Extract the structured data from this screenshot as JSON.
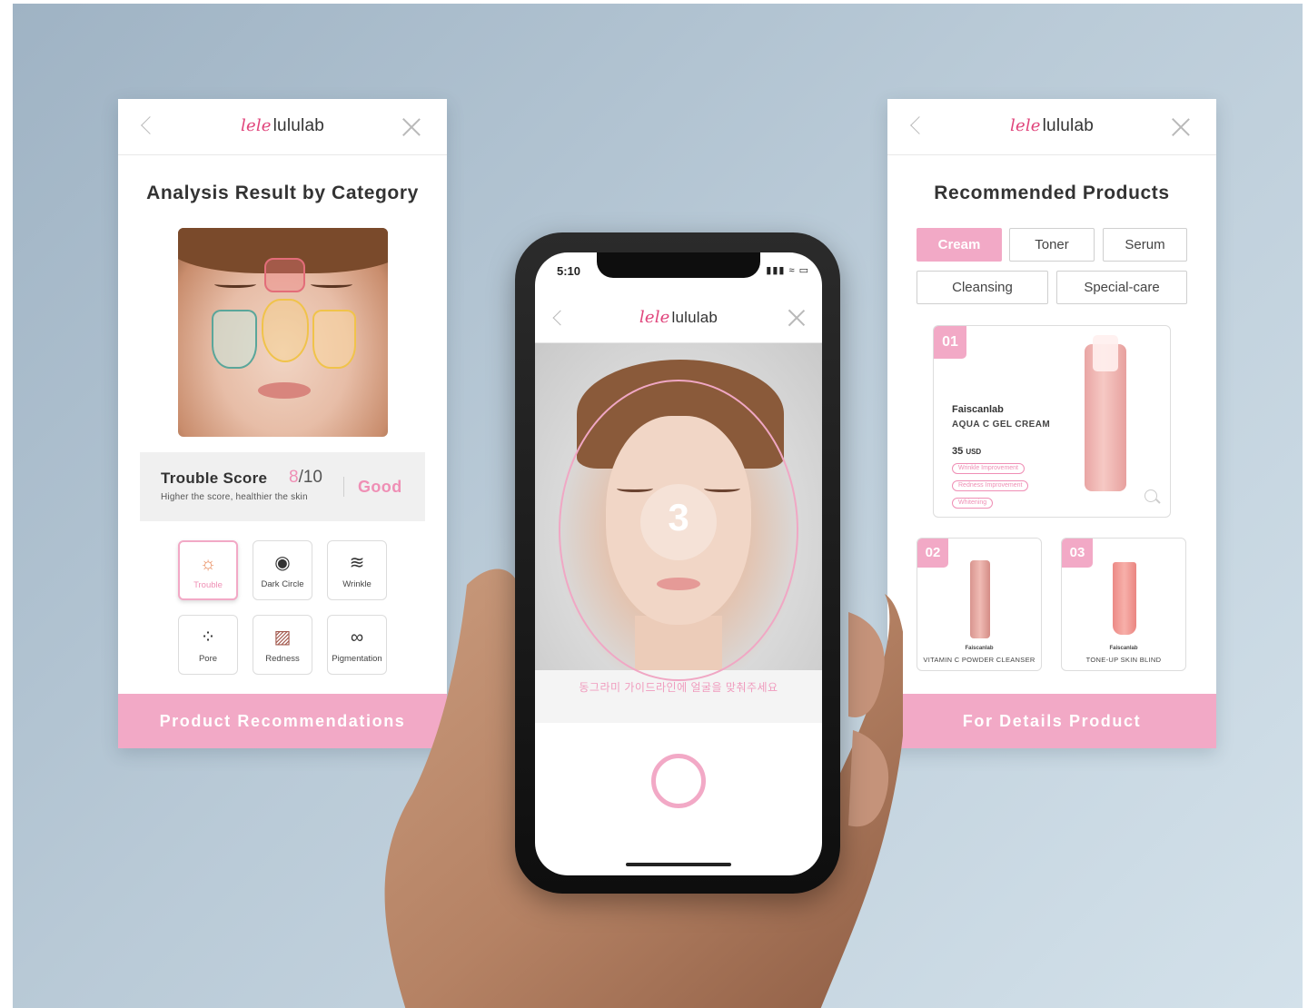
{
  "brand": {
    "logo_mark": "lele",
    "logo_text": "lululab"
  },
  "left_card": {
    "title": "Analysis Result by Category",
    "score": {
      "title": "Trouble Score",
      "value": "8",
      "max": "/10",
      "subtitle": "Higher the score, healthier the skin",
      "grade": "Good"
    },
    "categories": [
      {
        "label": "Trouble",
        "icon": "trouble-icon",
        "glyph": "☼"
      },
      {
        "label": "Dark Circle",
        "icon": "dark-circle-icon",
        "glyph": "◉"
      },
      {
        "label": "Wrinkle",
        "icon": "wrinkle-icon",
        "glyph": "≋"
      },
      {
        "label": "Pore",
        "icon": "pore-icon",
        "glyph": "⁘"
      },
      {
        "label": "Redness",
        "icon": "redness-icon",
        "glyph": "▨"
      },
      {
        "label": "Pigmentation",
        "icon": "pigmentation-icon",
        "glyph": "∞"
      }
    ],
    "active_category": "Trouble",
    "button": "Product Recommendations"
  },
  "phone": {
    "time": "5:10",
    "status_icons": "▮▮▮ ≈ ▭",
    "countdown": "3",
    "guide_text": "동그라미 가이드라인에 얼굴을 맞춰주세요"
  },
  "right_card": {
    "title": "Recommended Products",
    "tabs": [
      "Cream",
      "Toner",
      "Serum",
      "Cleansing",
      "Special-care"
    ],
    "active_tab": "Cream",
    "products": [
      {
        "rank": "01",
        "brand": "Faiscanlab",
        "name": "AQUA C GEL CREAM",
        "price": "35",
        "currency": "USD",
        "tags": [
          "Wrinkle Improvement",
          "Redness Improvement",
          "Whitening"
        ]
      },
      {
        "rank": "02",
        "brand": "Faiscanlab",
        "name": "VITAMIN C POWDER CLEANSER"
      },
      {
        "rank": "03",
        "brand": "Faiscanlab",
        "name": "TONE-UP SKIN BLIND"
      }
    ],
    "button": "For Details Product"
  },
  "colors": {
    "accent_pink": "#f2a9c6",
    "text_pink": "#ef8fb5",
    "background": "#b9cad7"
  }
}
